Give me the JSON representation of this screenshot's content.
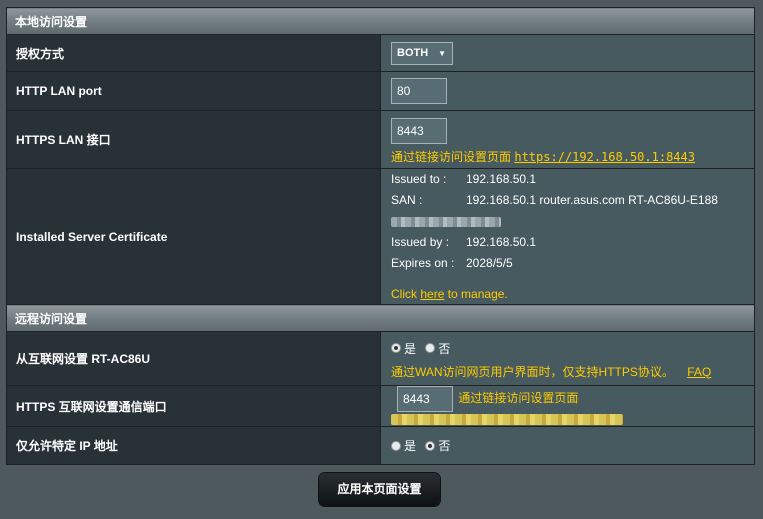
{
  "local": {
    "header": "本地访问设置",
    "auth_label": "授权方式",
    "auth_value": "BOTH",
    "http_label": "HTTP LAN port",
    "http_value": "80",
    "https_label": "HTTPS LAN 接口",
    "https_value": "8443",
    "https_hint": "通过链接访问设置页面",
    "https_url": "https://192.168.50.1:8443",
    "cert_label": "Installed Server Certificate",
    "cert": {
      "issued_to_key": "Issued to :",
      "issued_to_val": "192.168.50.1",
      "san_key": "SAN :",
      "san_val": "192.168.50.1 router.asus.com RT-AC86U-E188",
      "issued_by_key": "Issued by :",
      "issued_by_val": "192.168.50.1",
      "expires_key": "Expires on :",
      "expires_val": "2028/5/5"
    },
    "manage_pre": "Click",
    "manage_link": "here",
    "manage_post": "to manage."
  },
  "remote": {
    "header": "远程访问设置",
    "wan_label": "从互联网设置 RT-AC86U",
    "yes": "是",
    "no": "否",
    "wan_note": "通过WAN访问网页用户界面时，仅支持HTTPS协议。",
    "faq": "FAQ",
    "port_label": "HTTPS 互联网设置通信端口",
    "port_value": "8443",
    "port_hint": "通过链接访问设置页面",
    "ip_label": "仅允许特定 IP 地址"
  },
  "apply_label": "应用本页面设置"
}
